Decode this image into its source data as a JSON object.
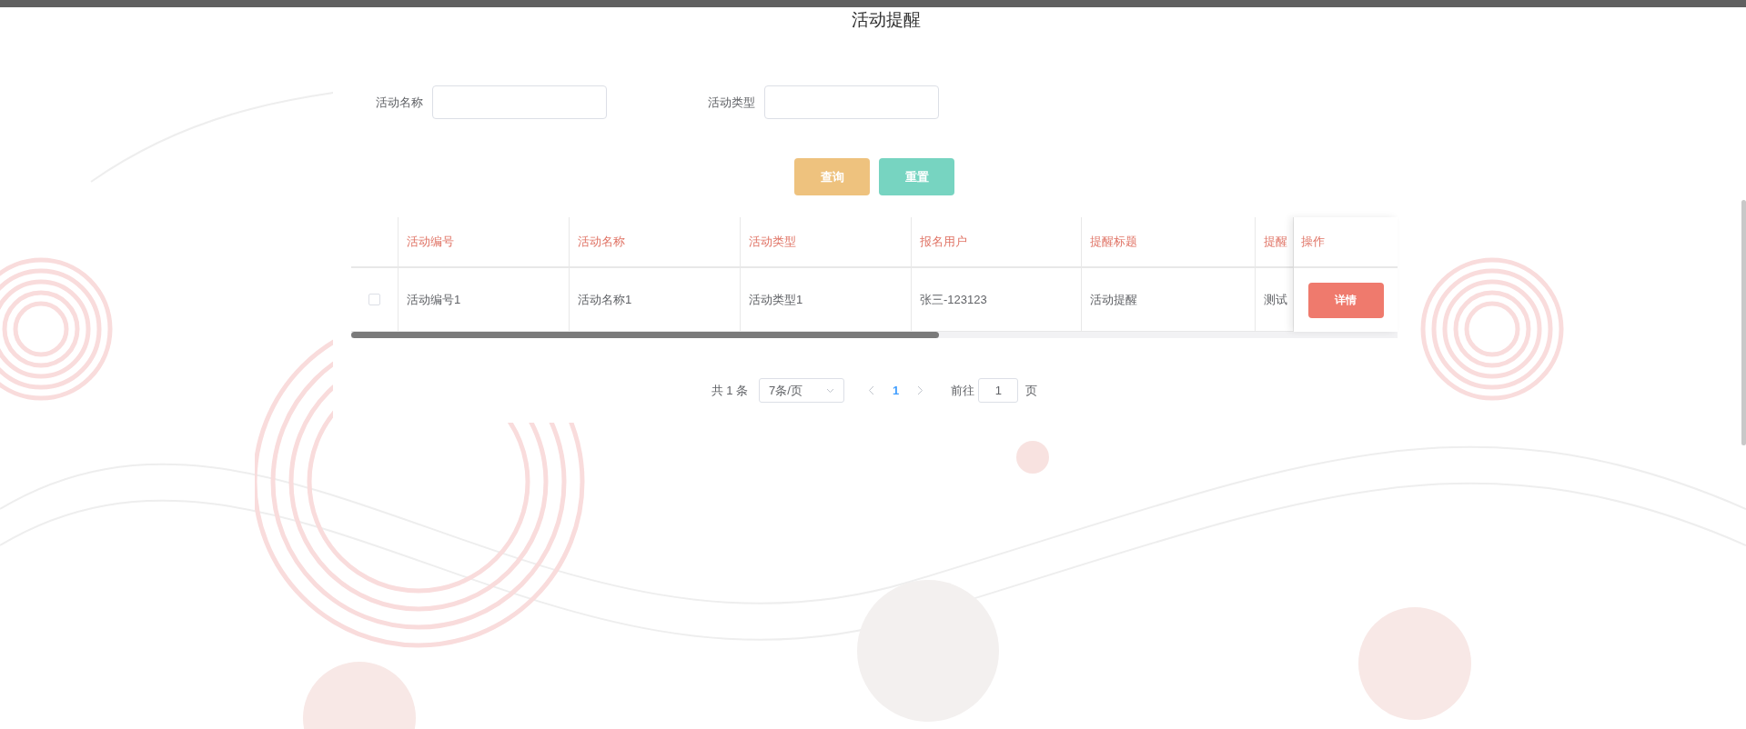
{
  "title": "活动提醒",
  "search": {
    "fields": [
      {
        "label": "活动名称"
      },
      {
        "label": "活动类型"
      }
    ],
    "buttons": [
      {
        "label": "查询",
        "kind": "query"
      },
      {
        "label": "重置",
        "kind": "reset"
      }
    ]
  },
  "table": {
    "columns": [
      "活动编号",
      "活动名称",
      "活动类型",
      "报名用户",
      "提醒标题",
      "提醒"
    ],
    "action_column": "操作",
    "rows": [
      {
        "checked": false,
        "cells": [
          "活动编号1",
          "活动名称1",
          "活动类型1",
          "张三-123123",
          "活动提醒",
          "测试"
        ],
        "action": "详情"
      }
    ]
  },
  "pagination": {
    "total": "共 1 条",
    "page_size": "7条/页",
    "pages": [
      {
        "label": "1",
        "selected": true
      }
    ],
    "goto_label": "前往",
    "goto_value": "1",
    "goto_suffix": "页"
  }
}
